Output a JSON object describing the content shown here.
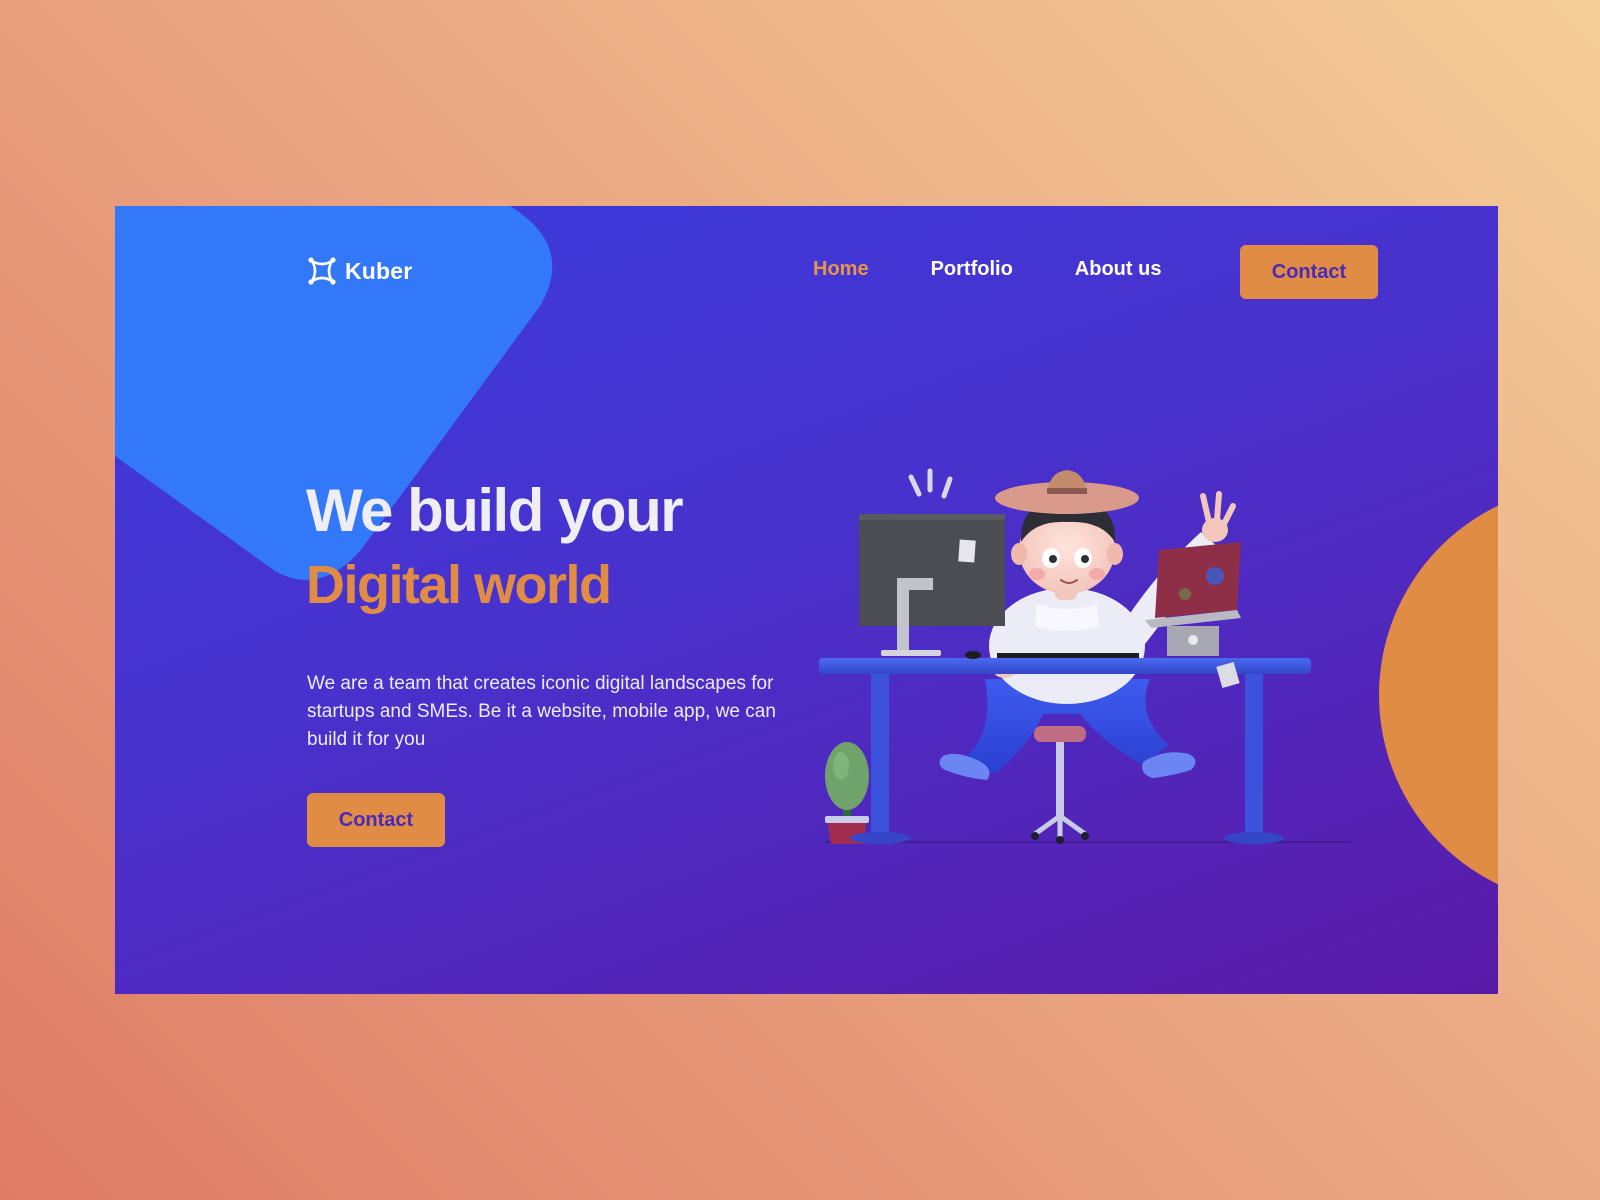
{
  "brand": {
    "name": "Kuber",
    "icon": "kuber-logo-icon"
  },
  "nav": {
    "items": [
      {
        "label": "Home",
        "active": true
      },
      {
        "label": "Portfolio",
        "active": false
      },
      {
        "label": "About us",
        "active": false
      }
    ],
    "contact_label": "Contact"
  },
  "hero": {
    "title_line1": "We build your",
    "title_line2": "Digital world",
    "description": "We are a team that creates iconic digital landscapes for startups and SMEs. Be it a website, mobile app, we can build it for you",
    "cta_label": "Contact"
  },
  "colors": {
    "accent": "#e18c44",
    "frame_start": "#3a3bde",
    "frame_end": "#5a1aa8",
    "blob": "#3478fa",
    "nav_active": "#e8954a"
  }
}
